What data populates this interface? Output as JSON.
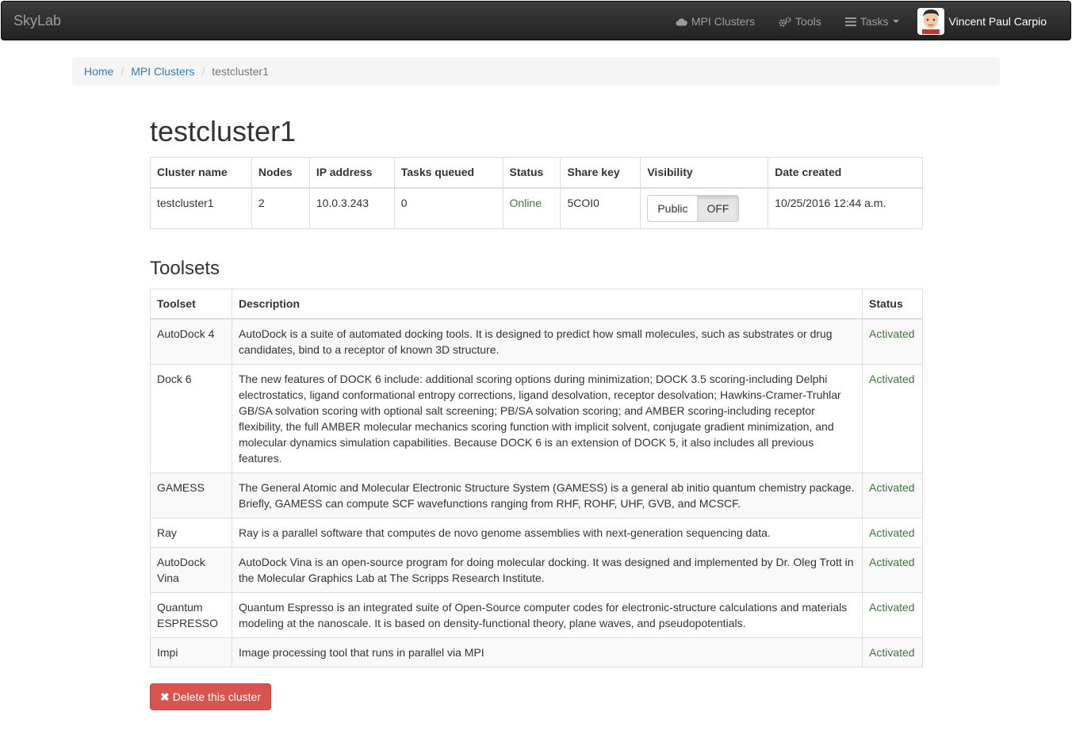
{
  "navbar": {
    "brand": "SkyLab",
    "items": [
      {
        "label": "MPI Clusters",
        "icon": "cloud-icon"
      },
      {
        "label": "Tools",
        "icon": "cogs-icon"
      },
      {
        "label": "Tasks",
        "icon": "tasks-icon"
      }
    ],
    "user_name": "Vincent Paul Carpio"
  },
  "breadcrumb": {
    "home": "Home",
    "clusters": "MPI Clusters",
    "current": "testcluster1"
  },
  "page_title": "testcluster1",
  "cluster_table": {
    "headers": [
      "Cluster name",
      "Nodes",
      "IP address",
      "Tasks queued",
      "Status",
      "Share key",
      "Visibility",
      "Date created"
    ],
    "row": {
      "name": "testcluster1",
      "nodes": "2",
      "ip": "10.0.3.243",
      "tasks_queued": "0",
      "status": "Online",
      "share_key": "5COI0",
      "visibility_public": "Public",
      "visibility_off": "OFF",
      "date_created": "10/25/2016 12:44 a.m."
    }
  },
  "toolsets_title": "Toolsets",
  "toolsets_table": {
    "headers": [
      "Toolset",
      "Description",
      "Status"
    ],
    "rows": [
      {
        "toolset": "AutoDock 4",
        "description": "AutoDock is a suite of automated docking tools. It is designed to predict how small molecules, such as substrates or drug candidates, bind to a receptor of known 3D structure.",
        "status": "Activated"
      },
      {
        "toolset": "Dock 6",
        "description": "The new features of DOCK 6 include: additional scoring options during minimization; DOCK 3.5 scoring-including Delphi electrostatics, ligand conformational entropy corrections, ligand desolvation, receptor desolvation; Hawkins-Cramer-Truhlar GB/SA solvation scoring with optional salt screening; PB/SA solvation scoring; and AMBER scoring-including receptor flexibility, the full AMBER molecular mechanics scoring function with implicit solvent, conjugate gradient minimization, and molecular dynamics simulation capabilities. Because DOCK 6 is an extension of DOCK 5, it also includes all previous features.",
        "status": "Activated"
      },
      {
        "toolset": "GAMESS",
        "description": "The General Atomic and Molecular Electronic Structure System (GAMESS) is a general ab initio quantum chemistry package. Briefly, GAMESS can compute SCF wavefunctions ranging from RHF, ROHF, UHF, GVB, and MCSCF.",
        "status": "Activated"
      },
      {
        "toolset": "Ray",
        "description": "Ray is a parallel software that computes de novo genome assemblies with next-generation sequencing data.",
        "status": "Activated"
      },
      {
        "toolset": "AutoDock Vina",
        "description": "AutoDock Vina is an open-source program for doing molecular docking. It was designed and implemented by Dr. Oleg Trott in the Molecular Graphics Lab at The Scripps Research Institute.",
        "status": "Activated"
      },
      {
        "toolset": "Quantum ESPRESSO",
        "description": "Quantum Espresso is an integrated suite of Open-Source computer codes for electronic-structure calculations and materials modeling at the nanoscale. It is based on density-functional theory, plane waves, and pseudopotentials.",
        "status": "Activated"
      },
      {
        "toolset": "Impi",
        "description": "Image processing tool that runs in parallel via MPI",
        "status": "Activated"
      }
    ]
  },
  "delete_button": "Delete this cluster",
  "colors": {
    "link": "#337ab7",
    "success": "#3c763d",
    "danger": "#d9534f",
    "navbar": "#222222"
  }
}
